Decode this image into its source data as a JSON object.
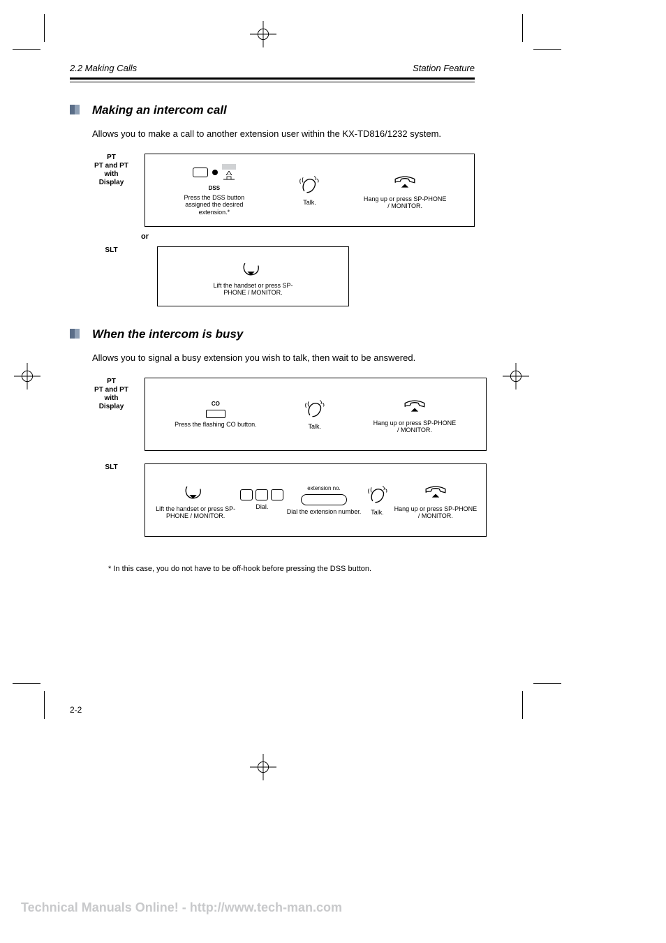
{
  "header": {
    "chapter_left": "2.2 Making Calls",
    "chapter_right": "Station Feature"
  },
  "section1": {
    "title": "Making an intercom call",
    "intro": "Allows you to make a call to another extension user within the KX-TD816/1232 system.",
    "phone_labels": {
      "pt": "PT",
      "pt_display": "PT and PT with Display",
      "slt": "SLT"
    },
    "row1": {
      "step1": {
        "label1": "DSS",
        "caption": "Press the DSS button assigned the desired extension.*"
      },
      "step2": {
        "caption": "Talk."
      },
      "step3": {
        "caption": "Hang up or press SP-PHONE / MONITOR."
      }
    },
    "or": "or",
    "row2": {
      "step1": {
        "caption": "Lift the handset or press SP-PHONE / MONITOR."
      }
    }
  },
  "section2": {
    "title": "When the intercom is busy",
    "intro": "Allows you to signal a busy extension you wish to talk, then wait to be answered.",
    "phone_labels": {
      "pt": "PT",
      "pt_display": "PT and PT with Display",
      "slt": "SLT"
    },
    "row1": {
      "step1": {
        "label": "CO",
        "caption": "Press the flashing CO button."
      },
      "step2": {
        "caption": "Talk."
      },
      "step3": {
        "caption": "Hang up or press SP-PHONE / MONITOR."
      }
    },
    "row2": {
      "step1": {
        "caption": "Lift the handset or press SP-PHONE / MONITOR."
      },
      "step2": {
        "caption": "Dial."
      },
      "step3": {
        "label": "extension no.",
        "caption": "Dial the extension number."
      },
      "step4": {
        "caption": "Talk."
      },
      "step5": {
        "caption": "Hang up or press SP-PHONE / MONITOR."
      }
    }
  },
  "note": "* In this case, you do not have to be off-hook before pressing the DSS button.",
  "page_number": "2-2",
  "footer": "Technical Manuals Online! - http://www.tech-man.com"
}
